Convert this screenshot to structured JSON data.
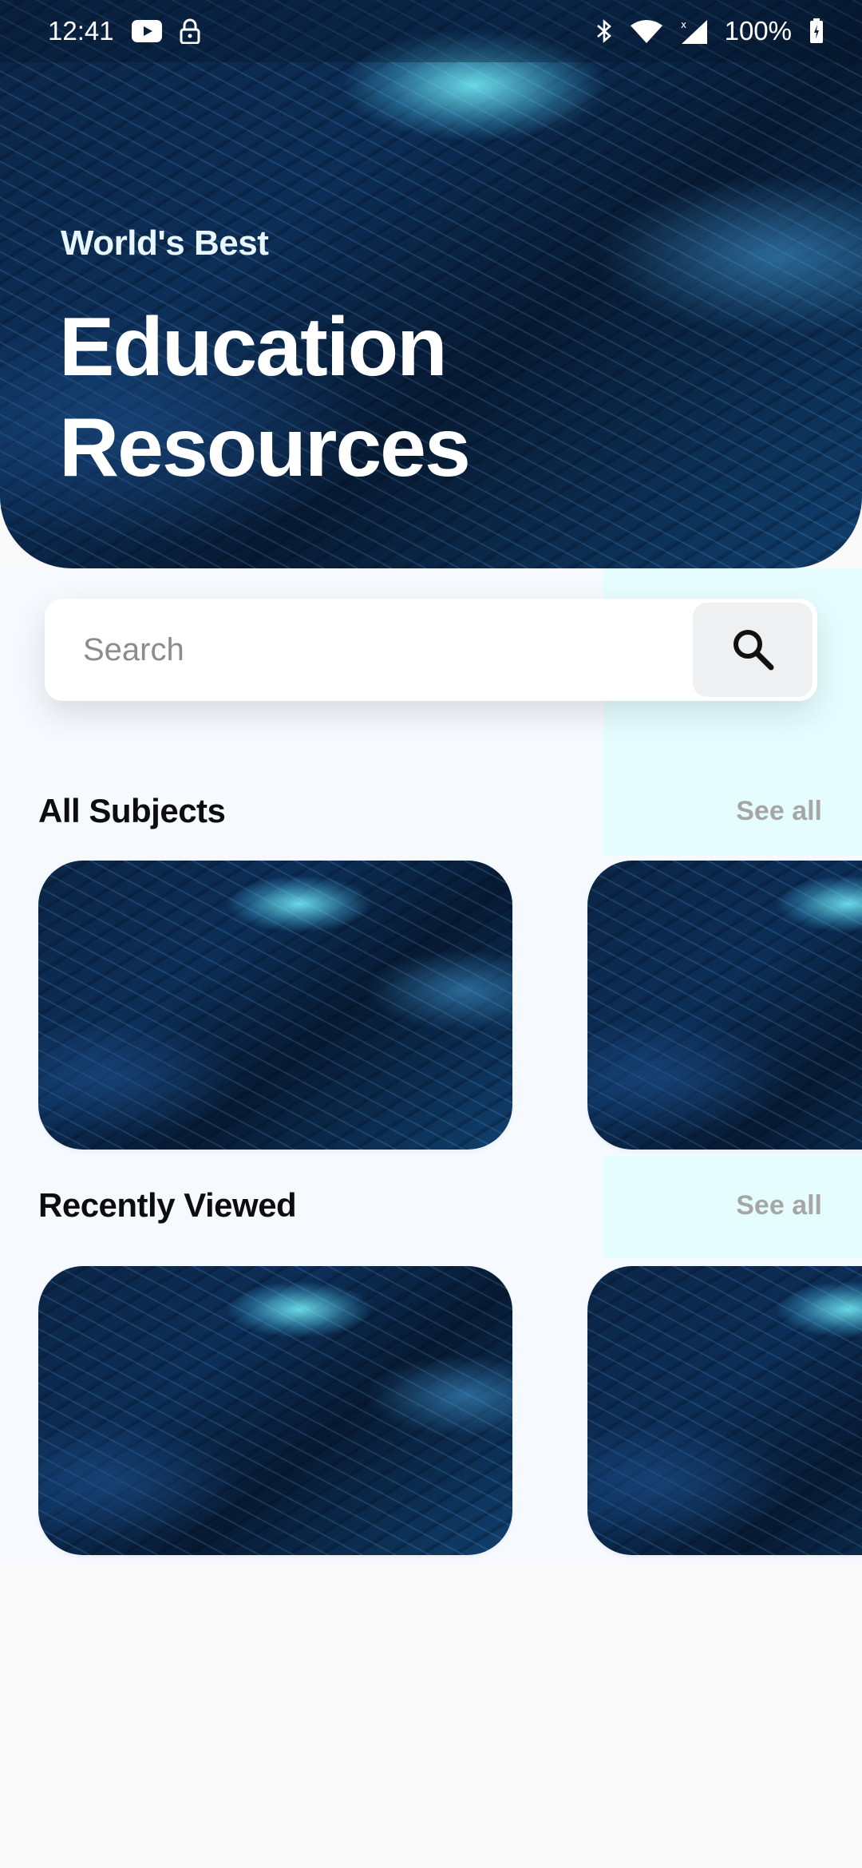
{
  "status_bar": {
    "time": "12:41",
    "battery": "100%",
    "icons": [
      "youtube-icon",
      "lock-icon",
      "bluetooth-icon",
      "wifi-icon",
      "signal-icon",
      "battery-icon"
    ]
  },
  "hero": {
    "kicker": "World's Best",
    "title_line1": "Education",
    "title_line2": "Resources"
  },
  "search": {
    "placeholder": "Search",
    "button_icon": "search-icon"
  },
  "sections": {
    "all_subjects": {
      "title": "All Subjects",
      "see_all": "See all",
      "cards": 2
    },
    "recently_viewed": {
      "title": "Recently Viewed",
      "see_all": "See all",
      "cards": 2
    }
  },
  "colors": {
    "hero_dark": "#0a1f3a",
    "accent_cyan": "#7ff3ff",
    "page_bg": "#f6faff",
    "tint": "#e6fdff",
    "see_all": "#a6a6a6"
  }
}
